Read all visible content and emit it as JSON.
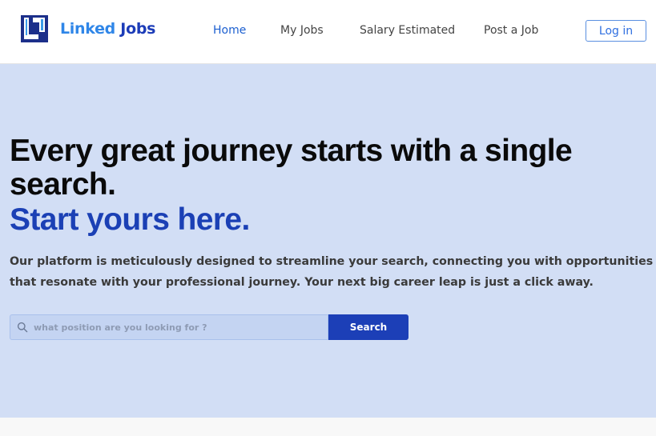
{
  "brand": {
    "part1": "Linked",
    "part2": "Jobs",
    "icon": "linked-jobs-logo"
  },
  "nav": {
    "home": "Home",
    "my_jobs": "My Jobs",
    "salary": "Salary Estimated",
    "post_job": "Post a Job",
    "login": "Log in"
  },
  "hero": {
    "headline": "Every great journey starts with a single search.",
    "subheadline": "Start yours here.",
    "description": "Our platform is meticulously designed to streamline your search, connecting you with opportunities that resonate with your professional journey. Your next big career leap is just a click away."
  },
  "search": {
    "placeholder": "what position are you looking for ?",
    "value": "",
    "button": "Search",
    "icon": "search-icon"
  },
  "colors": {
    "accent": "#1c3fb7",
    "brand_light": "#2f86e8",
    "hero_bg": "#d2def5",
    "nav_active": "#1c5fd0"
  }
}
